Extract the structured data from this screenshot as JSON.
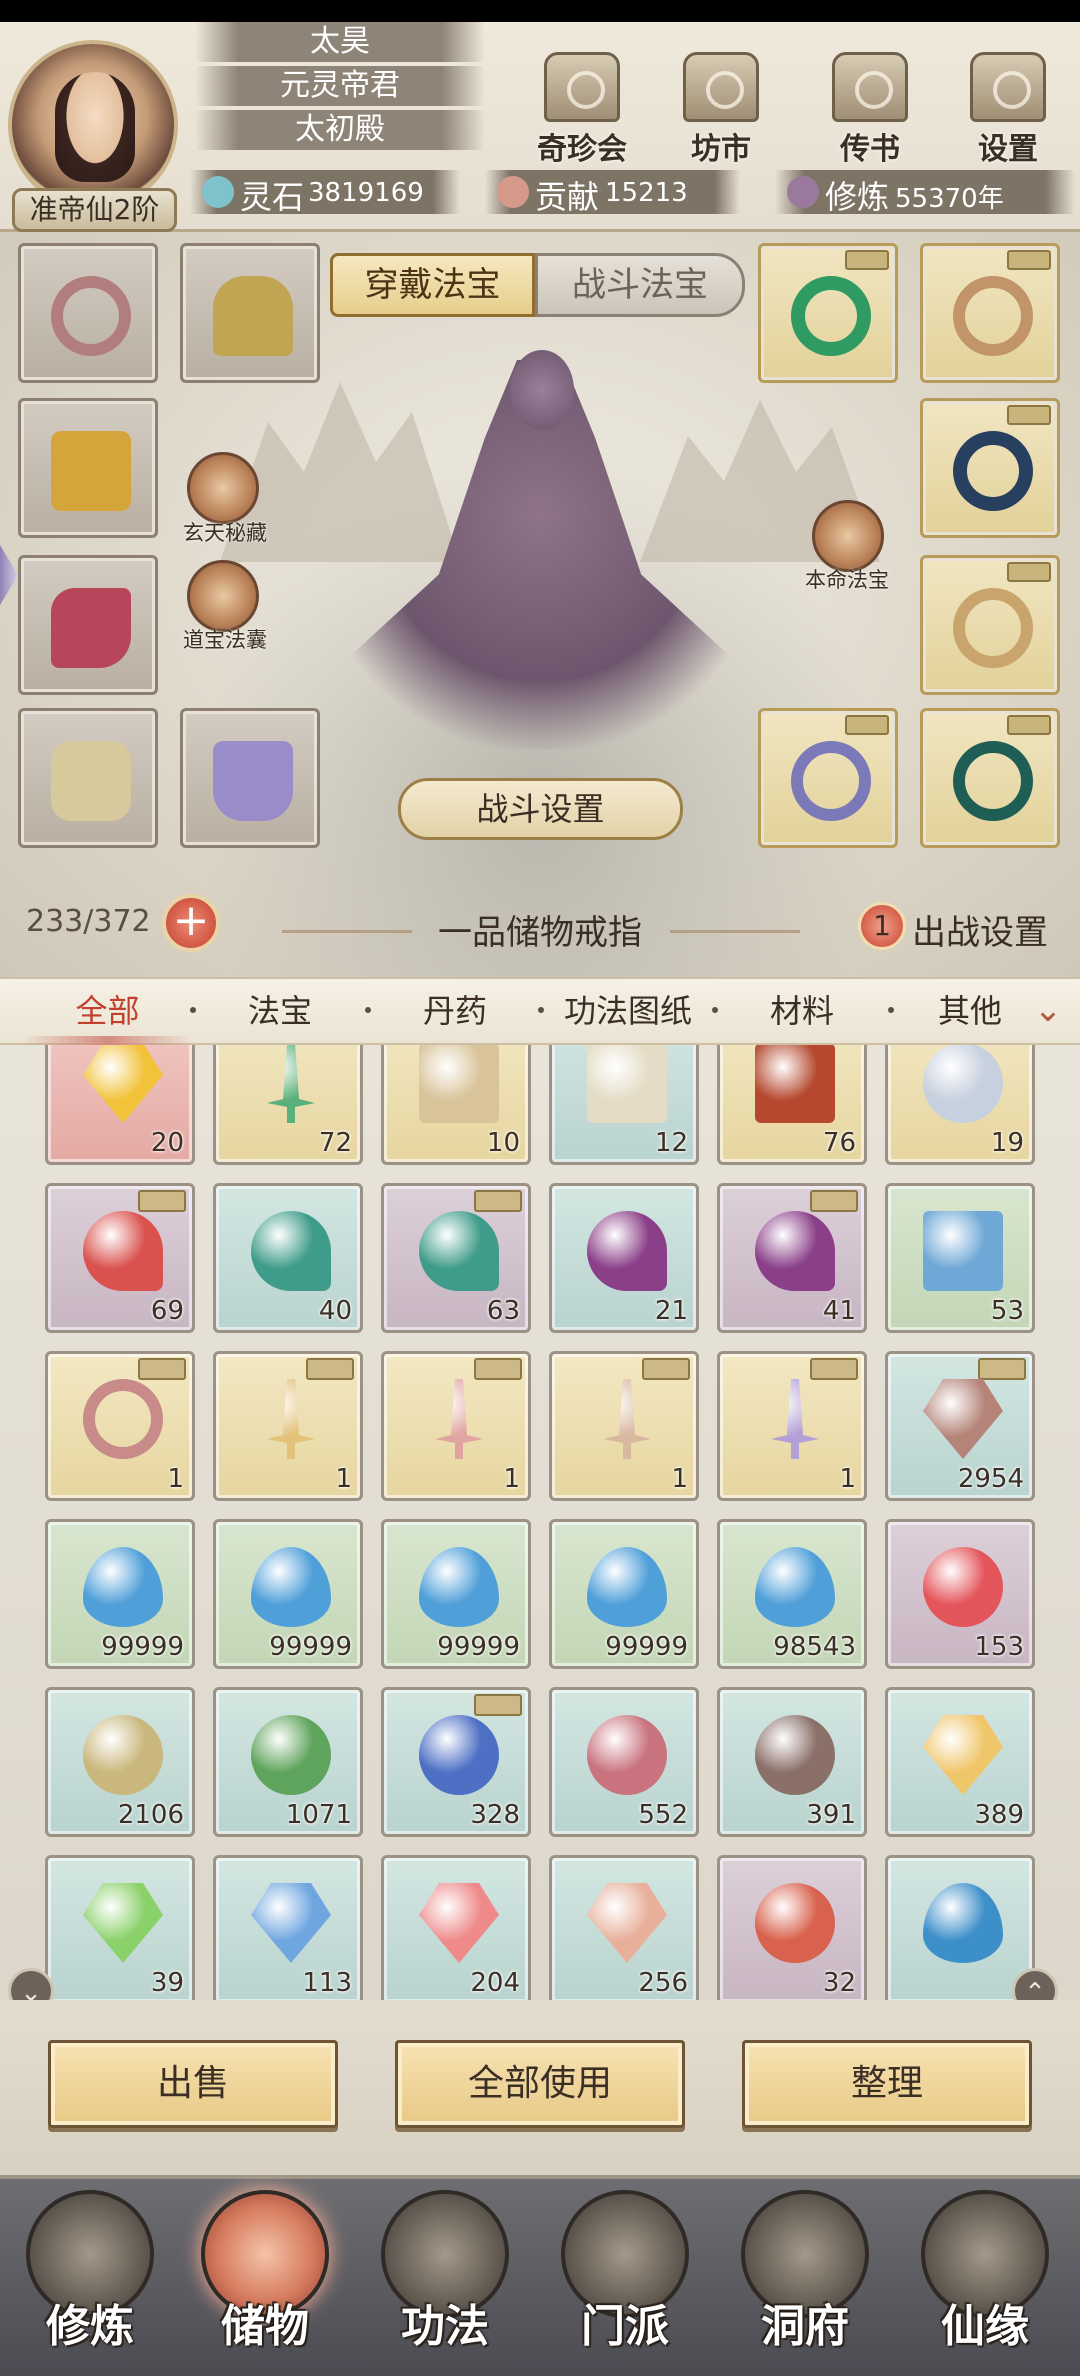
{
  "player": {
    "name": "太昊",
    "title": "元灵帝君",
    "palace": "太初殿",
    "realm": "准帝仙2阶"
  },
  "top_menu": [
    {
      "label": "奇珍会",
      "icon": "treasure-hall-icon"
    },
    {
      "label": "坊市",
      "icon": "market-icon"
    },
    {
      "label": "传书",
      "icon": "mail-scroll-icon"
    },
    {
      "label": "设置",
      "icon": "gear-icon"
    }
  ],
  "resources": {
    "spirit_stone": {
      "label": "灵石",
      "value": "3819169",
      "icon": "spirit-stone-icon"
    },
    "contribution": {
      "label": "贡献",
      "value": "15213",
      "icon": "contribution-icon"
    },
    "cultivation": {
      "label": "修炼",
      "value": "55370年",
      "icon": "cultivation-icon"
    }
  },
  "equip": {
    "tabs": {
      "wear": "穿戴法宝",
      "battle": "战斗法宝"
    },
    "left_buttons": [
      {
        "label": "玄天秘藏",
        "icon": "mystic-vault-icon"
      },
      {
        "label": "道宝法囊",
        "icon": "treasure-pouch-icon"
      }
    ],
    "right_button": {
      "label": "本命法宝",
      "icon": "natal-treasure-icon"
    },
    "battle_settings": "战斗设置",
    "capacity": "233/372",
    "ring_name": "一品储物戒指",
    "deploy_count": "1",
    "deploy_label": "出战设置"
  },
  "categories": [
    "全部",
    "法宝",
    "丹药",
    "功法图纸",
    "材料",
    "其他"
  ],
  "inventory": [
    {
      "qty": "20",
      "bg": "red",
      "color": "#f2c23a",
      "shape": "gem",
      "name": "gold-crystal-item"
    },
    {
      "qty": "72",
      "bg": "gold",
      "color": "#5ab07a",
      "shape": "sword",
      "name": "jade-dagger-item"
    },
    {
      "qty": "10",
      "bg": "gold",
      "color": "#d9c49a",
      "shape": "scroll",
      "name": "scroll-item"
    },
    {
      "qty": "12",
      "bg": "teal",
      "color": "#e4dcc6",
      "shape": "scroll",
      "name": "book-item"
    },
    {
      "qty": "76",
      "bg": "gold",
      "color": "#b5482e",
      "shape": "scroll",
      "name": "treasure-chest-item"
    },
    {
      "qty": "19",
      "bg": "gold",
      "color": "#c7d0de",
      "shape": "orb",
      "name": "jade-vase-item"
    },
    {
      "qty": "69",
      "bg": "purple",
      "color": "#d9524e",
      "shape": "flower",
      "name": "red-flower-item",
      "locked": true
    },
    {
      "qty": "40",
      "bg": "teal",
      "color": "#3f9c8a",
      "shape": "flower",
      "name": "teal-herb-item"
    },
    {
      "qty": "63",
      "bg": "purple",
      "color": "#3f9c8a",
      "shape": "flower",
      "name": "teal-herb-item",
      "locked": true
    },
    {
      "qty": "21",
      "bg": "teal",
      "color": "#8a3f88",
      "shape": "flower",
      "name": "purple-lotus-item"
    },
    {
      "qty": "41",
      "bg": "purple",
      "color": "#8a3f88",
      "shape": "flower",
      "name": "purple-lotus-item",
      "locked": true
    },
    {
      "qty": "53",
      "bg": "green",
      "color": "#6fa8d6",
      "shape": "scroll",
      "name": "blue-cloth-item"
    },
    {
      "qty": "1",
      "bg": "gold",
      "color": "#c98a8a",
      "shape": "ring",
      "name": "ring-item",
      "locked": true
    },
    {
      "qty": "1",
      "bg": "gold",
      "color": "#e3c27a",
      "shape": "sword",
      "name": "gold-sword-item",
      "locked": true
    },
    {
      "qty": "1",
      "bg": "gold",
      "color": "#e0a5a0",
      "shape": "sword",
      "name": "pink-sword-item",
      "locked": true
    },
    {
      "qty": "1",
      "bg": "gold",
      "color": "#d9b8a0",
      "shape": "sword",
      "name": "ivory-sword-item",
      "locked": true
    },
    {
      "qty": "1",
      "bg": "gold",
      "color": "#b3a0d6",
      "shape": "sword",
      "name": "violet-sword-item",
      "locked": true
    },
    {
      "qty": "2954",
      "bg": "teal",
      "color": "#b58479",
      "shape": "gem",
      "name": "sand-pile-item",
      "locked": true
    },
    {
      "qty": "99999",
      "bg": "green",
      "color": "#4f9fd9",
      "shape": "drop",
      "name": "water-drop-item"
    },
    {
      "qty": "99999",
      "bg": "green",
      "color": "#4f9fd9",
      "shape": "drop",
      "name": "water-drop-item"
    },
    {
      "qty": "99999",
      "bg": "green",
      "color": "#4f9fd9",
      "shape": "drop",
      "name": "water-drop-item"
    },
    {
      "qty": "99999",
      "bg": "green",
      "color": "#4f9fd9",
      "shape": "drop",
      "name": "water-drop-item"
    },
    {
      "qty": "98543",
      "bg": "green",
      "color": "#4f9fd9",
      "shape": "drop",
      "name": "water-drop-item"
    },
    {
      "qty": "153",
      "bg": "purple",
      "color": "#e4555b",
      "shape": "orb",
      "name": "red-pearl-item"
    },
    {
      "qty": "2106",
      "bg": "teal",
      "color": "#c9b77d",
      "shape": "orb",
      "name": "yellow-orb-item"
    },
    {
      "qty": "1071",
      "bg": "teal",
      "color": "#5fa45c",
      "shape": "orb",
      "name": "green-orb-item"
    },
    {
      "qty": "328",
      "bg": "teal",
      "color": "#4d6fc4",
      "shape": "orb",
      "name": "blue-orb-item",
      "locked": true
    },
    {
      "qty": "552",
      "bg": "teal",
      "color": "#c9737e",
      "shape": "orb",
      "name": "rose-orb-item"
    },
    {
      "qty": "391",
      "bg": "teal",
      "color": "#8a7068",
      "shape": "orb",
      "name": "brown-orb-item"
    },
    {
      "qty": "389",
      "bg": "teal",
      "color": "#f0c66a",
      "shape": "gem",
      "name": "amber-gem-item"
    },
    {
      "qty": "39",
      "bg": "teal",
      "color": "#8bd16a",
      "shape": "gem",
      "name": "green-gem-item"
    },
    {
      "qty": "113",
      "bg": "teal",
      "color": "#6fa6e0",
      "shape": "gem",
      "name": "blue-gem-item"
    },
    {
      "qty": "204",
      "bg": "teal",
      "color": "#ef8a8a",
      "shape": "gem",
      "name": "pink-gem-item"
    },
    {
      "qty": "256",
      "bg": "teal",
      "color": "#e8b09a",
      "shape": "gem",
      "name": "peach-gem-item"
    },
    {
      "qty": "32",
      "bg": "purple",
      "color": "#d9624e",
      "shape": "orb",
      "name": "flame-orb-item"
    },
    {
      "qty": "",
      "bg": "teal",
      "color": "#3d8fc9",
      "shape": "drop",
      "name": "wave-item"
    }
  ],
  "actions": {
    "sell": "出售",
    "use_all": "全部使用",
    "organize": "整理"
  },
  "bottom_nav": [
    {
      "label": "修炼",
      "icon": "cultivate-nav-icon"
    },
    {
      "label": "储物",
      "icon": "storage-nav-icon",
      "active": true
    },
    {
      "label": "功法",
      "icon": "technique-nav-icon"
    },
    {
      "label": "门派",
      "icon": "sect-nav-icon"
    },
    {
      "label": "洞府",
      "icon": "cave-dwelling-nav-icon"
    },
    {
      "label": "仙缘",
      "icon": "immortal-fate-nav-icon"
    }
  ]
}
